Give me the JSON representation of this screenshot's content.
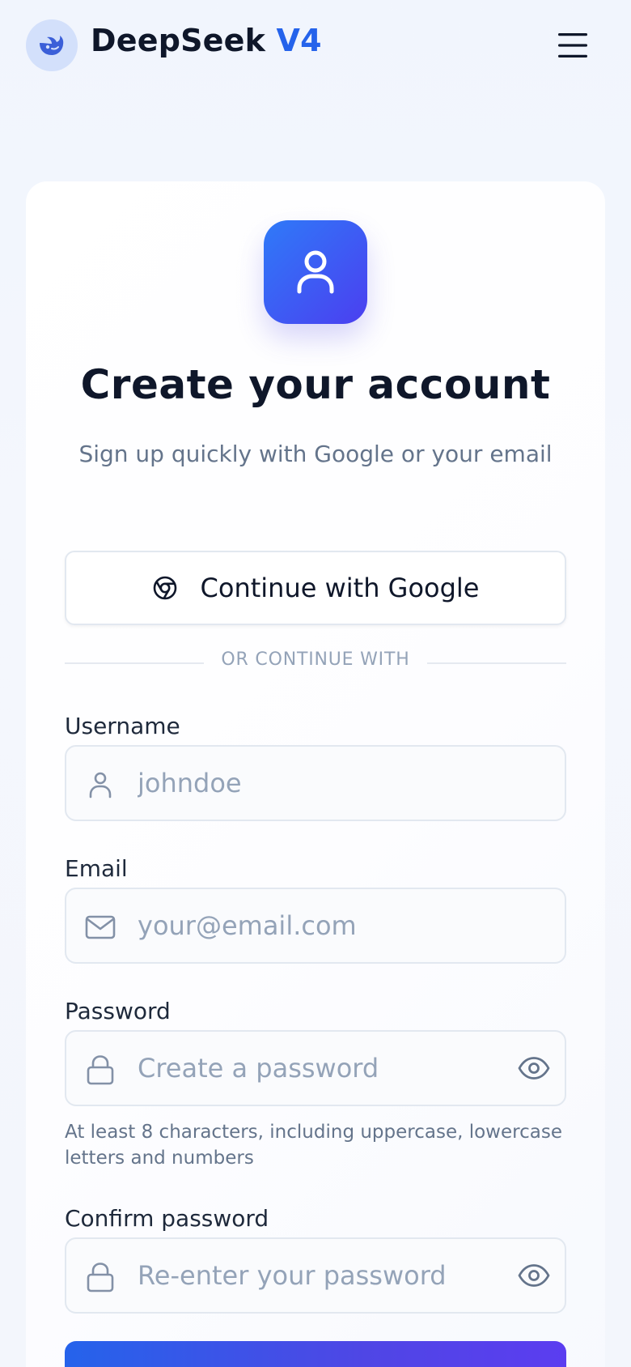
{
  "header": {
    "brand_name": "DeepSeek",
    "brand_version": "V4",
    "menu_icon": "hamburger-menu-icon"
  },
  "card": {
    "app_icon": "user-icon",
    "title": "Create your account",
    "subtitle": "Sign up quickly with Google or your email",
    "google_button_label": "Continue with Google",
    "divider_text": "OR CONTINUE WITH"
  },
  "form": {
    "username": {
      "label": "Username",
      "placeholder": "johndoe",
      "value": ""
    },
    "email": {
      "label": "Email",
      "placeholder": "your@email.com",
      "value": ""
    },
    "password": {
      "label": "Password",
      "placeholder": "Create a password",
      "value": "",
      "hint": "At least 8 characters, including uppercase, lowercase letters and numbers"
    },
    "confirm_password": {
      "label": "Confirm password",
      "placeholder": "Re-enter your password",
      "value": ""
    }
  },
  "colors": {
    "accent": "#2563eb",
    "accent_secondary": "#4f46e5",
    "text_primary": "#0f172a",
    "text_muted": "#64748b",
    "placeholder": "#94a3b8"
  }
}
